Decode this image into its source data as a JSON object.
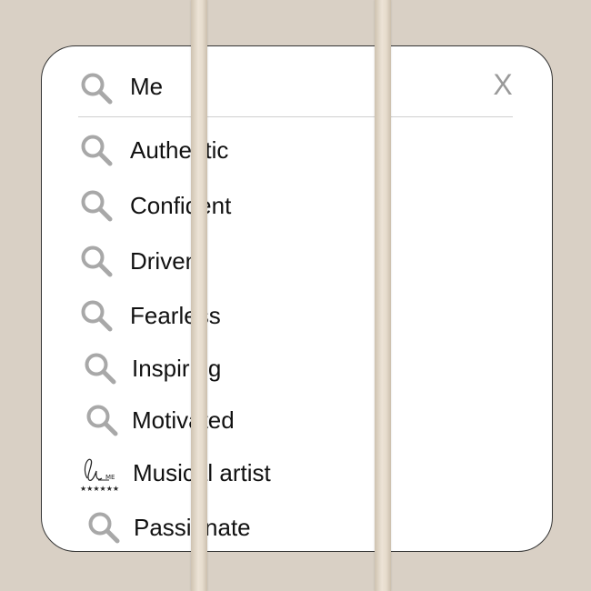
{
  "search": {
    "query": "Me",
    "clear_label": "X",
    "icon": "search-icon"
  },
  "suggestions": [
    {
      "label": "Authentic",
      "icon": "search-icon"
    },
    {
      "label": "Confident",
      "icon": "search-icon"
    },
    {
      "label": "Driven",
      "icon": "search-icon"
    },
    {
      "label": "Fearless",
      "icon": "search-icon"
    },
    {
      "label": "Inspiring",
      "icon": "search-icon"
    },
    {
      "label": "Motivated",
      "icon": "search-icon"
    },
    {
      "label": "Musical artist",
      "icon": "signature-badge-icon"
    },
    {
      "label": "Passionate",
      "icon": "search-icon"
    }
  ],
  "colors": {
    "background": "#d9d0c5",
    "card": "#ffffff",
    "icon": "#a8a8a8",
    "text": "#111111",
    "cord": "#e6dccd"
  }
}
